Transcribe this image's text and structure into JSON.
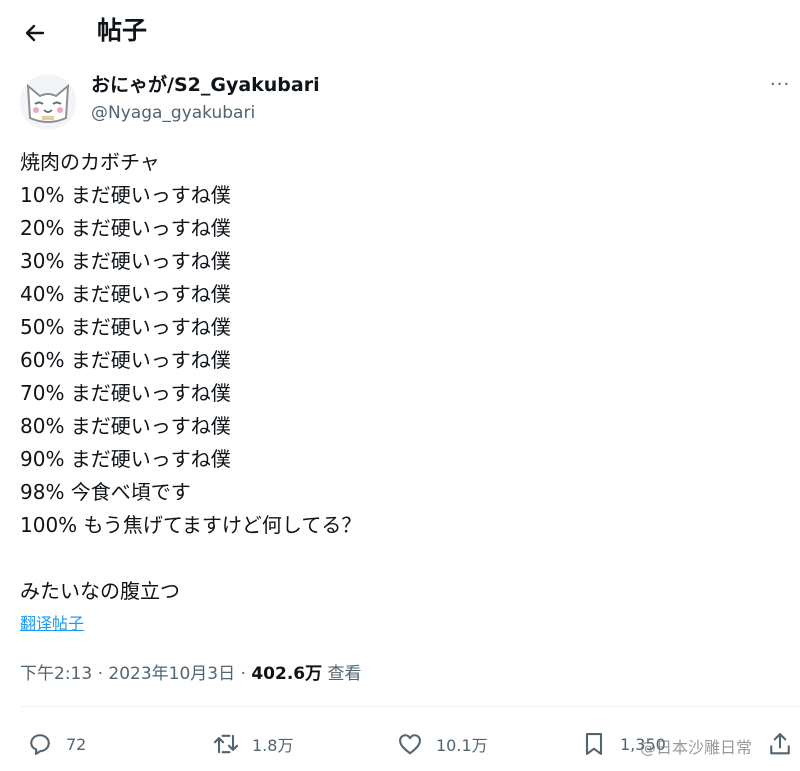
{
  "header": {
    "title": "帖子",
    "back_icon": "arrow-left-icon"
  },
  "author": {
    "name": "おにゃが/S2_Gyakubari",
    "handle": "@Nyaga_gyakubari",
    "more_label": "···"
  },
  "post": {
    "lines": [
      "焼肉のカボチャ",
      "10% まだ硬いっすね僕",
      "20% まだ硬いっすね僕",
      "30% まだ硬いっすね僕",
      "40% まだ硬いっすね僕",
      "50% まだ硬いっすね僕",
      "60% まだ硬いっすね僕",
      "70% まだ硬いっすね僕",
      "80% まだ硬いっすね僕",
      "90% まだ硬いっすね僕",
      "98%  今食べ頃です",
      "100% もう焦げてますけど何してる？",
      "",
      "みたいなの腹立つ"
    ],
    "translate_label": "翻译帖子"
  },
  "meta": {
    "time": "下午2:13",
    "separator": " · ",
    "date": "2023年10月3日",
    "views_count": "402.6万",
    "views_label": " 查看"
  },
  "actions": {
    "replies": "72",
    "reposts": "1.8万",
    "likes": "10.1万",
    "bookmarks": "1,350"
  },
  "watermark": "@日本沙雕日常",
  "colors": {
    "text": "#0f1419",
    "secondary": "#536471",
    "link": "#1d9bf0",
    "divider": "#eff3f4"
  }
}
